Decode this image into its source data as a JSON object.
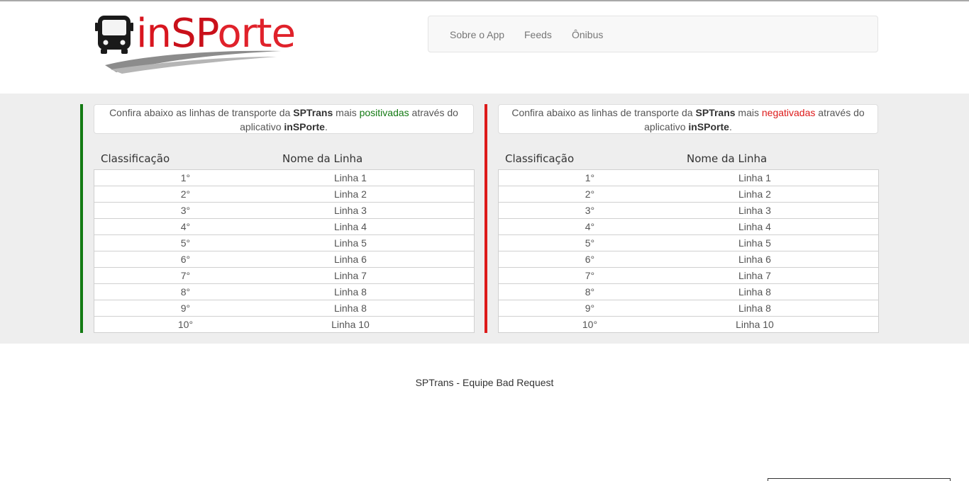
{
  "header": {
    "logo": {
      "text_in": "in",
      "text_sp": "SP",
      "text_orte": "orte"
    },
    "nav": [
      "Sobre o App",
      "Feeds",
      "Ônibus"
    ]
  },
  "colors": {
    "positive": "#137a13",
    "negative": "#dd1a1a",
    "band": "#eeeeee"
  },
  "positive_panel": {
    "intro": {
      "pre": "Confira abaixo as linhas de transporte da ",
      "brand": "SPTrans",
      "mid": " mais ",
      "highlight": "positivadas",
      "post": " através do aplicativo ",
      "app": "inSPorte",
      "end": "."
    },
    "col_rank": "Classificação",
    "col_name": "Nome da Linha",
    "rows": [
      {
        "rank": "1°",
        "name": "Linha 1"
      },
      {
        "rank": "2°",
        "name": "Linha 2"
      },
      {
        "rank": "3°",
        "name": "Linha 3"
      },
      {
        "rank": "4°",
        "name": "Linha 4"
      },
      {
        "rank": "5°",
        "name": "Linha 5"
      },
      {
        "rank": "6°",
        "name": "Linha 6"
      },
      {
        "rank": "7°",
        "name": "Linha 7"
      },
      {
        "rank": "8°",
        "name": "Linha 8"
      },
      {
        "rank": "9°",
        "name": "Linha 8"
      },
      {
        "rank": "10°",
        "name": "Linha 10"
      }
    ]
  },
  "negative_panel": {
    "intro": {
      "pre": "Confira abaixo as linhas de transporte da ",
      "brand": "SPTrans",
      "mid": " mais ",
      "highlight": "negativadas",
      "post": " através do aplicativo ",
      "app": "inSPorte",
      "end": "."
    },
    "col_rank": "Classificação",
    "col_name": "Nome da Linha",
    "rows": [
      {
        "rank": "1°",
        "name": "Linha 1"
      },
      {
        "rank": "2°",
        "name": "Linha 2"
      },
      {
        "rank": "3°",
        "name": "Linha 3"
      },
      {
        "rank": "4°",
        "name": "Linha 4"
      },
      {
        "rank": "5°",
        "name": "Linha 5"
      },
      {
        "rank": "6°",
        "name": "Linha 6"
      },
      {
        "rank": "7°",
        "name": "Linha 7"
      },
      {
        "rank": "8°",
        "name": "Linha 8"
      },
      {
        "rank": "9°",
        "name": "Linha 8"
      },
      {
        "rank": "10°",
        "name": "Linha 10"
      }
    ]
  },
  "footer": {
    "text": "SPTrans - Equipe Bad Request"
  }
}
